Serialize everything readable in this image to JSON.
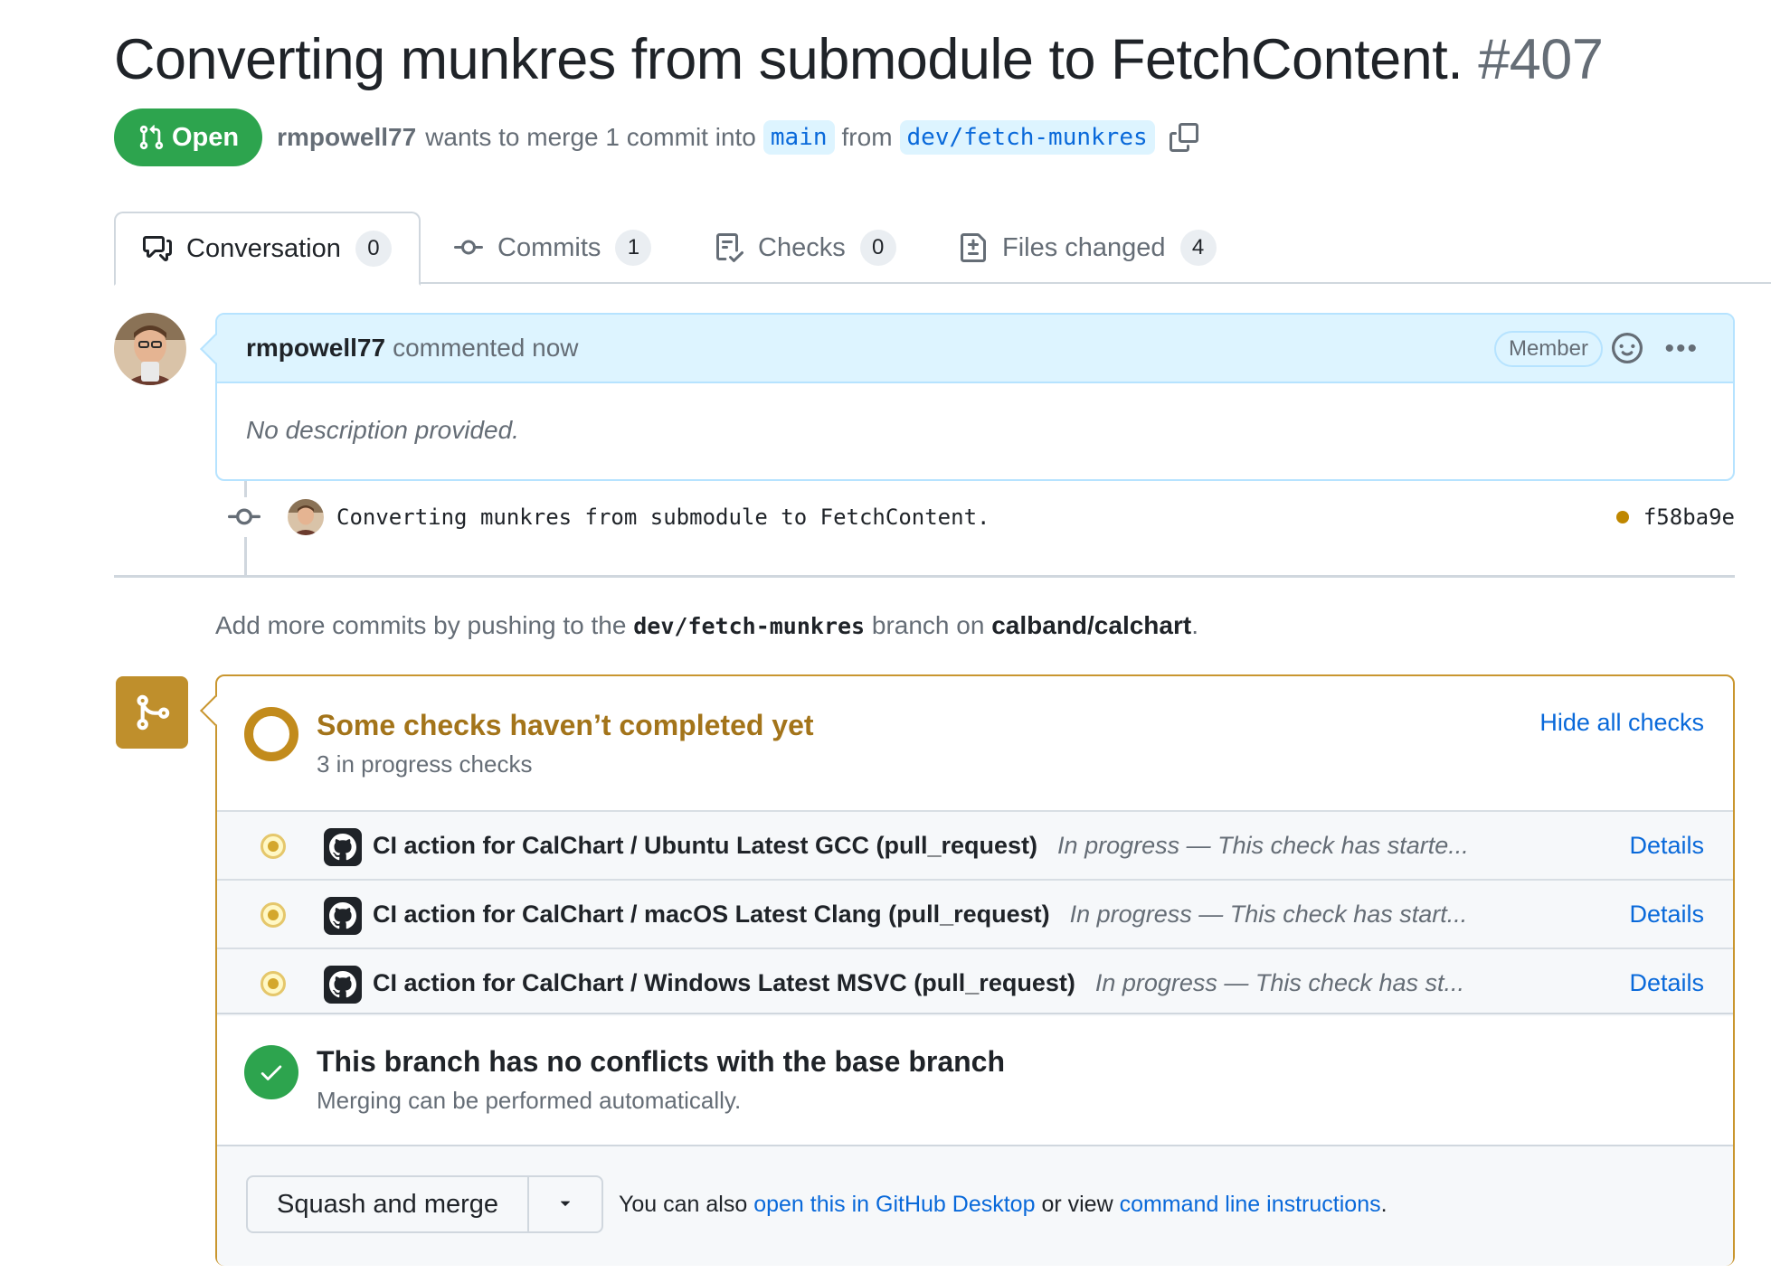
{
  "pr": {
    "title": "Converting munkres from submodule to FetchContent.",
    "number": "#407",
    "state": "Open",
    "author": "rmpowell77",
    "summary_mid": "wants to merge 1 commit into",
    "base_branch": "main",
    "from_word": "from",
    "head_branch": "dev/fetch-munkres"
  },
  "tabs": [
    {
      "label": "Conversation",
      "count": "0",
      "icon": "comment-discussion-icon"
    },
    {
      "label": "Commits",
      "count": "1",
      "icon": "git-commit-icon"
    },
    {
      "label": "Checks",
      "count": "0",
      "icon": "checklist-icon"
    },
    {
      "label": "Files changed",
      "count": "4",
      "icon": "file-diff-icon"
    }
  ],
  "comment": {
    "author": "rmpowell77",
    "action": "commented now",
    "role_badge": "Member",
    "body": "No description provided."
  },
  "commit": {
    "message": "Converting munkres from submodule to FetchContent.",
    "sha": "f58ba9e",
    "status_color": "#bf8700"
  },
  "push_hint": {
    "prefix": "Add more commits by pushing to the",
    "branch": "dev/fetch-munkres",
    "middle": "branch on",
    "repo": "calband/calchart",
    "suffix": "."
  },
  "checks": {
    "title": "Some checks haven’t completed yet",
    "subtitle": "3 in progress checks",
    "hide_link": "Hide all checks",
    "items": [
      {
        "name": "CI action for CalChart / Ubuntu Latest GCC (pull_request)",
        "status": "In progress — This check has starte...",
        "details": "Details"
      },
      {
        "name": "CI action for CalChart / macOS Latest Clang (pull_request)",
        "status": "In progress — This check has start...",
        "details": "Details"
      },
      {
        "name": "CI action for CalChart / Windows Latest MSVC (pull_request)",
        "status": "In progress — This check has st...",
        "details": "Details"
      }
    ]
  },
  "conflicts": {
    "title": "This branch has no conflicts with the base branch",
    "subtitle": "Merging can be performed automatically."
  },
  "merge": {
    "button_label": "Squash and merge",
    "note_prefix": "You can also",
    "desktop_link": "open this in GitHub Desktop",
    "note_middle": "or view",
    "cli_link": "command line instructions",
    "note_suffix": "."
  },
  "colors": {
    "open_green": "#2da44e",
    "pending_gold": "#bf8700",
    "link_blue": "#0969da"
  }
}
